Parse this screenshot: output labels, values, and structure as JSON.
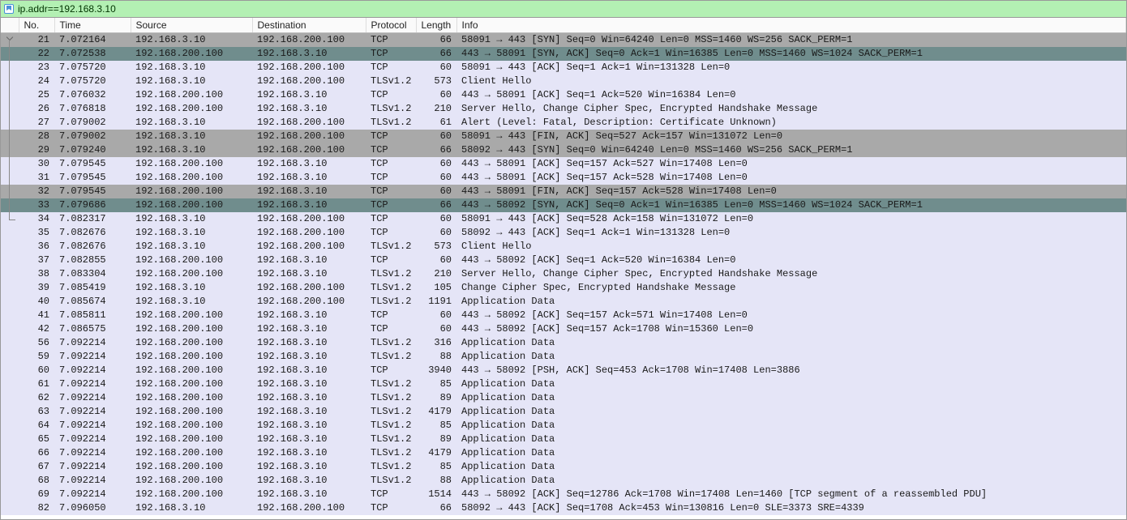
{
  "filter": {
    "text": "ip.addr==192.168.3.10"
  },
  "columns": [
    "No.",
    "Time",
    "Source",
    "Destination",
    "Protocol",
    "Length",
    "Info"
  ],
  "packets": [
    {
      "no": 21,
      "t": "7.072164",
      "s": "192.168.3.10",
      "d": "192.168.200.100",
      "p": "TCP",
      "l": 66,
      "i": "58091 → 443 [SYN] Seq=0 Win=64240 Len=0 MSS=1460 WS=256 SACK_PERM=1",
      "bg": "gray",
      "tree": "start"
    },
    {
      "no": 22,
      "t": "7.072538",
      "s": "192.168.200.100",
      "d": "192.168.3.10",
      "p": "TCP",
      "l": 66,
      "i": "443 → 58091 [SYN, ACK] Seq=0 Ack=1 Win=16385 Len=0 MSS=1460 WS=1024 SACK_PERM=1",
      "bg": "teal",
      "tree": "mid"
    },
    {
      "no": 23,
      "t": "7.075720",
      "s": "192.168.3.10",
      "d": "192.168.200.100",
      "p": "TCP",
      "l": 60,
      "i": "58091 → 443 [ACK] Seq=1 Ack=1 Win=131328 Len=0",
      "bg": "lav",
      "tree": "mid"
    },
    {
      "no": 24,
      "t": "7.075720",
      "s": "192.168.3.10",
      "d": "192.168.200.100",
      "p": "TLSv1.2",
      "l": 573,
      "i": "Client Hello",
      "bg": "lav",
      "tree": "mid"
    },
    {
      "no": 25,
      "t": "7.076032",
      "s": "192.168.200.100",
      "d": "192.168.3.10",
      "p": "TCP",
      "l": 60,
      "i": "443 → 58091 [ACK] Seq=1 Ack=520 Win=16384 Len=0",
      "bg": "lav",
      "tree": "mid"
    },
    {
      "no": 26,
      "t": "7.076818",
      "s": "192.168.200.100",
      "d": "192.168.3.10",
      "p": "TLSv1.2",
      "l": 210,
      "i": "Server Hello, Change Cipher Spec, Encrypted Handshake Message",
      "bg": "lav",
      "tree": "mid"
    },
    {
      "no": 27,
      "t": "7.079002",
      "s": "192.168.3.10",
      "d": "192.168.200.100",
      "p": "TLSv1.2",
      "l": 61,
      "i": "Alert (Level: Fatal, Description: Certificate Unknown)",
      "bg": "lav",
      "tree": "mid"
    },
    {
      "no": 28,
      "t": "7.079002",
      "s": "192.168.3.10",
      "d": "192.168.200.100",
      "p": "TCP",
      "l": 60,
      "i": "58091 → 443 [FIN, ACK] Seq=527 Ack=157 Win=131072 Len=0",
      "bg": "gray",
      "tree": "mid"
    },
    {
      "no": 29,
      "t": "7.079240",
      "s": "192.168.3.10",
      "d": "192.168.200.100",
      "p": "TCP",
      "l": 66,
      "i": "58092 → 443 [SYN] Seq=0 Win=64240 Len=0 MSS=1460 WS=256 SACK_PERM=1",
      "bg": "gray",
      "tree": "mid"
    },
    {
      "no": 30,
      "t": "7.079545",
      "s": "192.168.200.100",
      "d": "192.168.3.10",
      "p": "TCP",
      "l": 60,
      "i": "443 → 58091 [ACK] Seq=157 Ack=527 Win=17408 Len=0",
      "bg": "lav",
      "tree": "mid"
    },
    {
      "no": 31,
      "t": "7.079545",
      "s": "192.168.200.100",
      "d": "192.168.3.10",
      "p": "TCP",
      "l": 60,
      "i": "443 → 58091 [ACK] Seq=157 Ack=528 Win=17408 Len=0",
      "bg": "lav",
      "tree": "mid"
    },
    {
      "no": 32,
      "t": "7.079545",
      "s": "192.168.200.100",
      "d": "192.168.3.10",
      "p": "TCP",
      "l": 60,
      "i": "443 → 58091 [FIN, ACK] Seq=157 Ack=528 Win=17408 Len=0",
      "bg": "gray",
      "tree": "mid"
    },
    {
      "no": 33,
      "t": "7.079686",
      "s": "192.168.200.100",
      "d": "192.168.3.10",
      "p": "TCP",
      "l": 66,
      "i": "443 → 58092 [SYN, ACK] Seq=0 Ack=1 Win=16385 Len=0 MSS=1460 WS=1024 SACK_PERM=1",
      "bg": "teal",
      "tree": "mid"
    },
    {
      "no": 34,
      "t": "7.082317",
      "s": "192.168.3.10",
      "d": "192.168.200.100",
      "p": "TCP",
      "l": 60,
      "i": "58091 → 443 [ACK] Seq=528 Ack=158 Win=131072 Len=0",
      "bg": "lav",
      "tree": "end"
    },
    {
      "no": 35,
      "t": "7.082676",
      "s": "192.168.3.10",
      "d": "192.168.200.100",
      "p": "TCP",
      "l": 60,
      "i": "58092 → 443 [ACK] Seq=1 Ack=1 Win=131328 Len=0",
      "bg": "lav",
      "tree": ""
    },
    {
      "no": 36,
      "t": "7.082676",
      "s": "192.168.3.10",
      "d": "192.168.200.100",
      "p": "TLSv1.2",
      "l": 573,
      "i": "Client Hello",
      "bg": "lav",
      "tree": ""
    },
    {
      "no": 37,
      "t": "7.082855",
      "s": "192.168.200.100",
      "d": "192.168.3.10",
      "p": "TCP",
      "l": 60,
      "i": "443 → 58092 [ACK] Seq=1 Ack=520 Win=16384 Len=0",
      "bg": "lav",
      "tree": ""
    },
    {
      "no": 38,
      "t": "7.083304",
      "s": "192.168.200.100",
      "d": "192.168.3.10",
      "p": "TLSv1.2",
      "l": 210,
      "i": "Server Hello, Change Cipher Spec, Encrypted Handshake Message",
      "bg": "lav",
      "tree": ""
    },
    {
      "no": 39,
      "t": "7.085419",
      "s": "192.168.3.10",
      "d": "192.168.200.100",
      "p": "TLSv1.2",
      "l": 105,
      "i": "Change Cipher Spec, Encrypted Handshake Message",
      "bg": "lav",
      "tree": ""
    },
    {
      "no": 40,
      "t": "7.085674",
      "s": "192.168.3.10",
      "d": "192.168.200.100",
      "p": "TLSv1.2",
      "l": 1191,
      "i": "Application Data",
      "bg": "lav",
      "tree": ""
    },
    {
      "no": 41,
      "t": "7.085811",
      "s": "192.168.200.100",
      "d": "192.168.3.10",
      "p": "TCP",
      "l": 60,
      "i": "443 → 58092 [ACK] Seq=157 Ack=571 Win=17408 Len=0",
      "bg": "lav",
      "tree": ""
    },
    {
      "no": 42,
      "t": "7.086575",
      "s": "192.168.200.100",
      "d": "192.168.3.10",
      "p": "TCP",
      "l": 60,
      "i": "443 → 58092 [ACK] Seq=157 Ack=1708 Win=15360 Len=0",
      "bg": "lav",
      "tree": ""
    },
    {
      "no": 56,
      "t": "7.092214",
      "s": "192.168.200.100",
      "d": "192.168.3.10",
      "p": "TLSv1.2",
      "l": 316,
      "i": "Application Data",
      "bg": "lav",
      "tree": ""
    },
    {
      "no": 59,
      "t": "7.092214",
      "s": "192.168.200.100",
      "d": "192.168.3.10",
      "p": "TLSv1.2",
      "l": 88,
      "i": "Application Data",
      "bg": "lav",
      "tree": ""
    },
    {
      "no": 60,
      "t": "7.092214",
      "s": "192.168.200.100",
      "d": "192.168.3.10",
      "p": "TCP",
      "l": 3940,
      "i": "443 → 58092 [PSH, ACK] Seq=453 Ack=1708 Win=17408 Len=3886",
      "bg": "lav",
      "tree": ""
    },
    {
      "no": 61,
      "t": "7.092214",
      "s": "192.168.200.100",
      "d": "192.168.3.10",
      "p": "TLSv1.2",
      "l": 85,
      "i": "Application Data",
      "bg": "lav",
      "tree": ""
    },
    {
      "no": 62,
      "t": "7.092214",
      "s": "192.168.200.100",
      "d": "192.168.3.10",
      "p": "TLSv1.2",
      "l": 89,
      "i": "Application Data",
      "bg": "lav",
      "tree": ""
    },
    {
      "no": 63,
      "t": "7.092214",
      "s": "192.168.200.100",
      "d": "192.168.3.10",
      "p": "TLSv1.2",
      "l": 4179,
      "i": "Application Data",
      "bg": "lav",
      "tree": ""
    },
    {
      "no": 64,
      "t": "7.092214",
      "s": "192.168.200.100",
      "d": "192.168.3.10",
      "p": "TLSv1.2",
      "l": 85,
      "i": "Application Data",
      "bg": "lav",
      "tree": ""
    },
    {
      "no": 65,
      "t": "7.092214",
      "s": "192.168.200.100",
      "d": "192.168.3.10",
      "p": "TLSv1.2",
      "l": 89,
      "i": "Application Data",
      "bg": "lav",
      "tree": ""
    },
    {
      "no": 66,
      "t": "7.092214",
      "s": "192.168.200.100",
      "d": "192.168.3.10",
      "p": "TLSv1.2",
      "l": 4179,
      "i": "Application Data",
      "bg": "lav",
      "tree": ""
    },
    {
      "no": 67,
      "t": "7.092214",
      "s": "192.168.200.100",
      "d": "192.168.3.10",
      "p": "TLSv1.2",
      "l": 85,
      "i": "Application Data",
      "bg": "lav",
      "tree": ""
    },
    {
      "no": 68,
      "t": "7.092214",
      "s": "192.168.200.100",
      "d": "192.168.3.10",
      "p": "TLSv1.2",
      "l": 88,
      "i": "Application Data",
      "bg": "lav",
      "tree": ""
    },
    {
      "no": 69,
      "t": "7.092214",
      "s": "192.168.200.100",
      "d": "192.168.3.10",
      "p": "TCP",
      "l": 1514,
      "i": "443 → 58092 [ACK] Seq=12786 Ack=1708 Win=17408 Len=1460 [TCP segment of a reassembled PDU]",
      "bg": "lav",
      "tree": ""
    },
    {
      "no": 82,
      "t": "7.096050",
      "s": "192.168.3.10",
      "d": "192.168.200.100",
      "p": "TCP",
      "l": 66,
      "i": "58092 → 443 [ACK] Seq=1708 Ack=453 Win=130816 Len=0 SLE=3373 SRE=4339",
      "bg": "lav",
      "tree": ""
    }
  ]
}
